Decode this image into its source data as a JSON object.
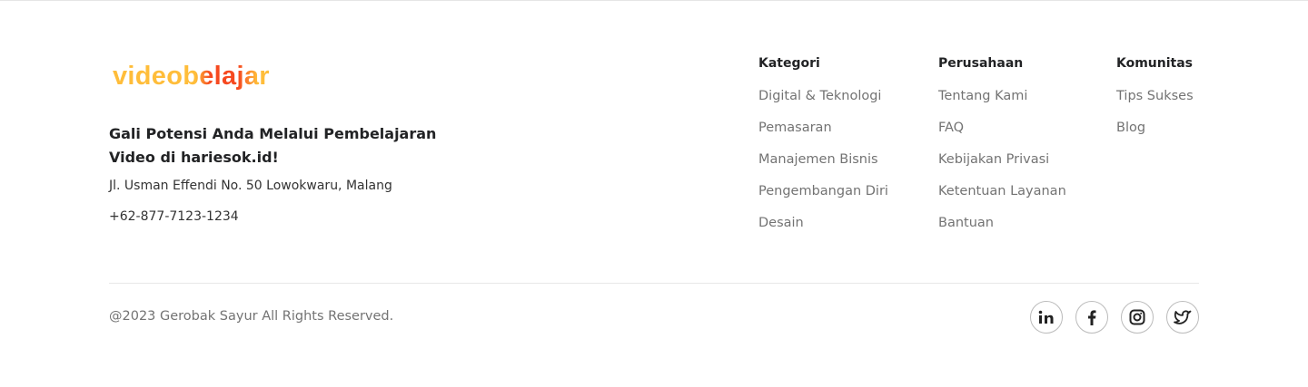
{
  "brand": {
    "logo_text": "videobelajar",
    "tagline": "Gali Potensi Anda Melalui Pembelajaran Video di hariesok.id!",
    "address": "Jl. Usman Effendi No. 50 Lowokwaru, Malang",
    "phone": "+62-877-7123-1234"
  },
  "columns": [
    {
      "title": "Kategori",
      "items": [
        "Digital & Teknologi",
        "Pemasaran",
        "Manajemen Bisnis",
        "Pengembangan Diri",
        "Desain"
      ]
    },
    {
      "title": "Perusahaan",
      "items": [
        "Tentang Kami",
        "FAQ",
        "Kebijakan Privasi",
        "Ketentuan Layanan",
        "Bantuan"
      ]
    },
    {
      "title": "Komunitas",
      "items": [
        "Tips Sukses",
        "Blog"
      ]
    }
  ],
  "copyright": "@2023 Gerobak Sayur All Rights Reserved.",
  "social": [
    "linkedin-icon",
    "facebook-icon",
    "instagram-icon",
    "twitter-icon"
  ]
}
